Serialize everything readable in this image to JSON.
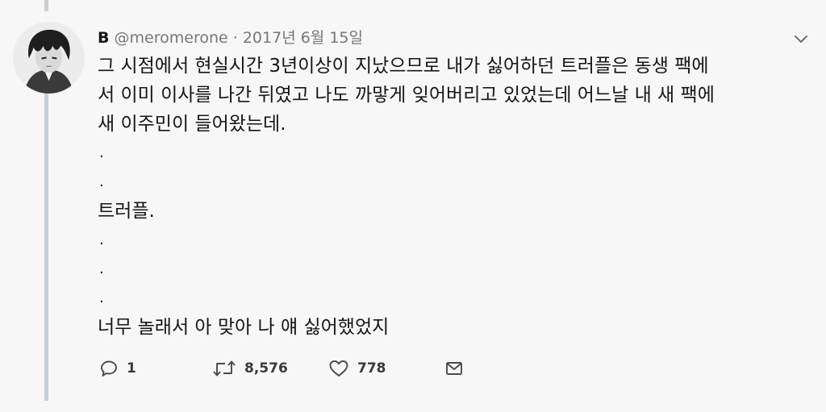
{
  "tweet": {
    "name": "B",
    "handle": "@meromerone",
    "separator": "·",
    "date": "2017년 6월 15일",
    "lines": [
      "그 시점에서 현실시간 3년이상이 지났으므로 내가 싫어하던 트러플은 동생 팩에",
      "서 이미 이사를 나간 뒤였고 나도 까맣게 잊어버리고 있었는데 어느날 내 새 팩에",
      "새 이주민이 들어왔는데.",
      ".",
      ".",
      "트러플.",
      ".",
      ".",
      ".",
      "너무 놀래서 아 맞아 나 얘 싫어했었지"
    ]
  },
  "actions": {
    "reply_count": "1",
    "retweet_count": "8,576",
    "like_count": "778"
  },
  "icons": {
    "reply": "reply-icon",
    "retweet": "retweet-icon",
    "like": "heart-icon",
    "message": "envelope-icon",
    "more": "chevron-down-icon"
  }
}
